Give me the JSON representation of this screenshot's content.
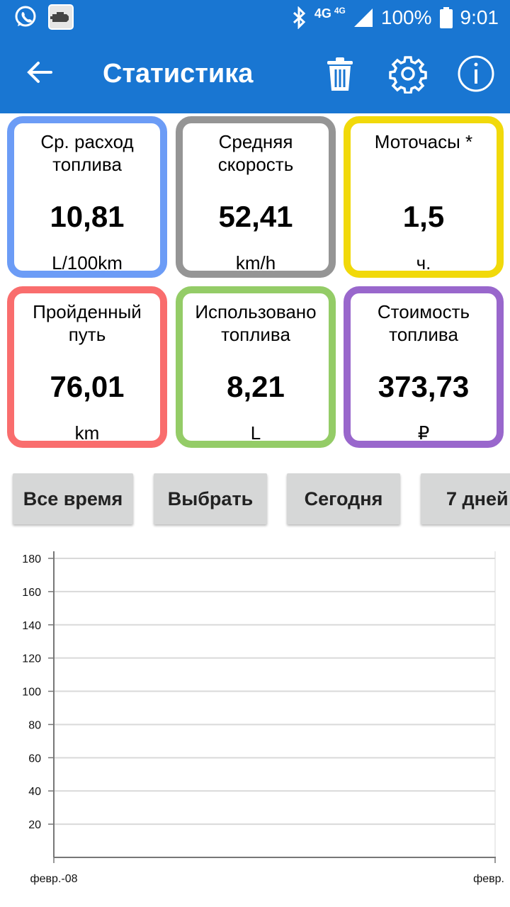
{
  "status_bar": {
    "network_1": "4G",
    "network_2": "4G",
    "battery": "100%",
    "time": "9:01",
    "icons": [
      "whatsapp-icon",
      "car-engine-icon",
      "bluetooth-icon",
      "signal-icon",
      "battery-icon"
    ]
  },
  "app_bar": {
    "title": "Статистика",
    "icons": [
      "back-arrow-icon",
      "trash-icon",
      "gear-icon",
      "info-icon"
    ]
  },
  "cards": [
    {
      "label": "Ср. расход топлива",
      "value": "10,81",
      "unit": "L/100km",
      "color": "#6c9cf6"
    },
    {
      "label": "Средняя скорость",
      "value": "52,41",
      "unit": "km/h",
      "color": "#959595"
    },
    {
      "label": "Моточасы *",
      "value": "1,5",
      "unit": "ч.",
      "color": "#f1d90a"
    },
    {
      "label": "Пройденный путь",
      "value": "76,01",
      "unit": "km",
      "color": "#f96d6d"
    },
    {
      "label": "Использовано топлива",
      "value": "8,21",
      "unit": "L",
      "color": "#94cc67"
    },
    {
      "label": "Стоимость топлива",
      "value": "373,73",
      "unit": "₽",
      "color": "#9967cc"
    }
  ],
  "tabs": [
    "Все время",
    "Выбрать",
    "Сегодня",
    "7 дней"
  ],
  "chart_data": {
    "type": "line",
    "x": [
      "февр.-08",
      "февр."
    ],
    "series": [],
    "ylim": [
      0,
      180
    ],
    "yticks": [
      20,
      40,
      60,
      80,
      100,
      120,
      140,
      160,
      180
    ],
    "grid": true,
    "title": "",
    "xlabel": "",
    "ylabel": ""
  },
  "colors": {
    "primary": "#1976d2",
    "tab_bg": "#d6d7d7",
    "grid": "#d9d9d9"
  }
}
